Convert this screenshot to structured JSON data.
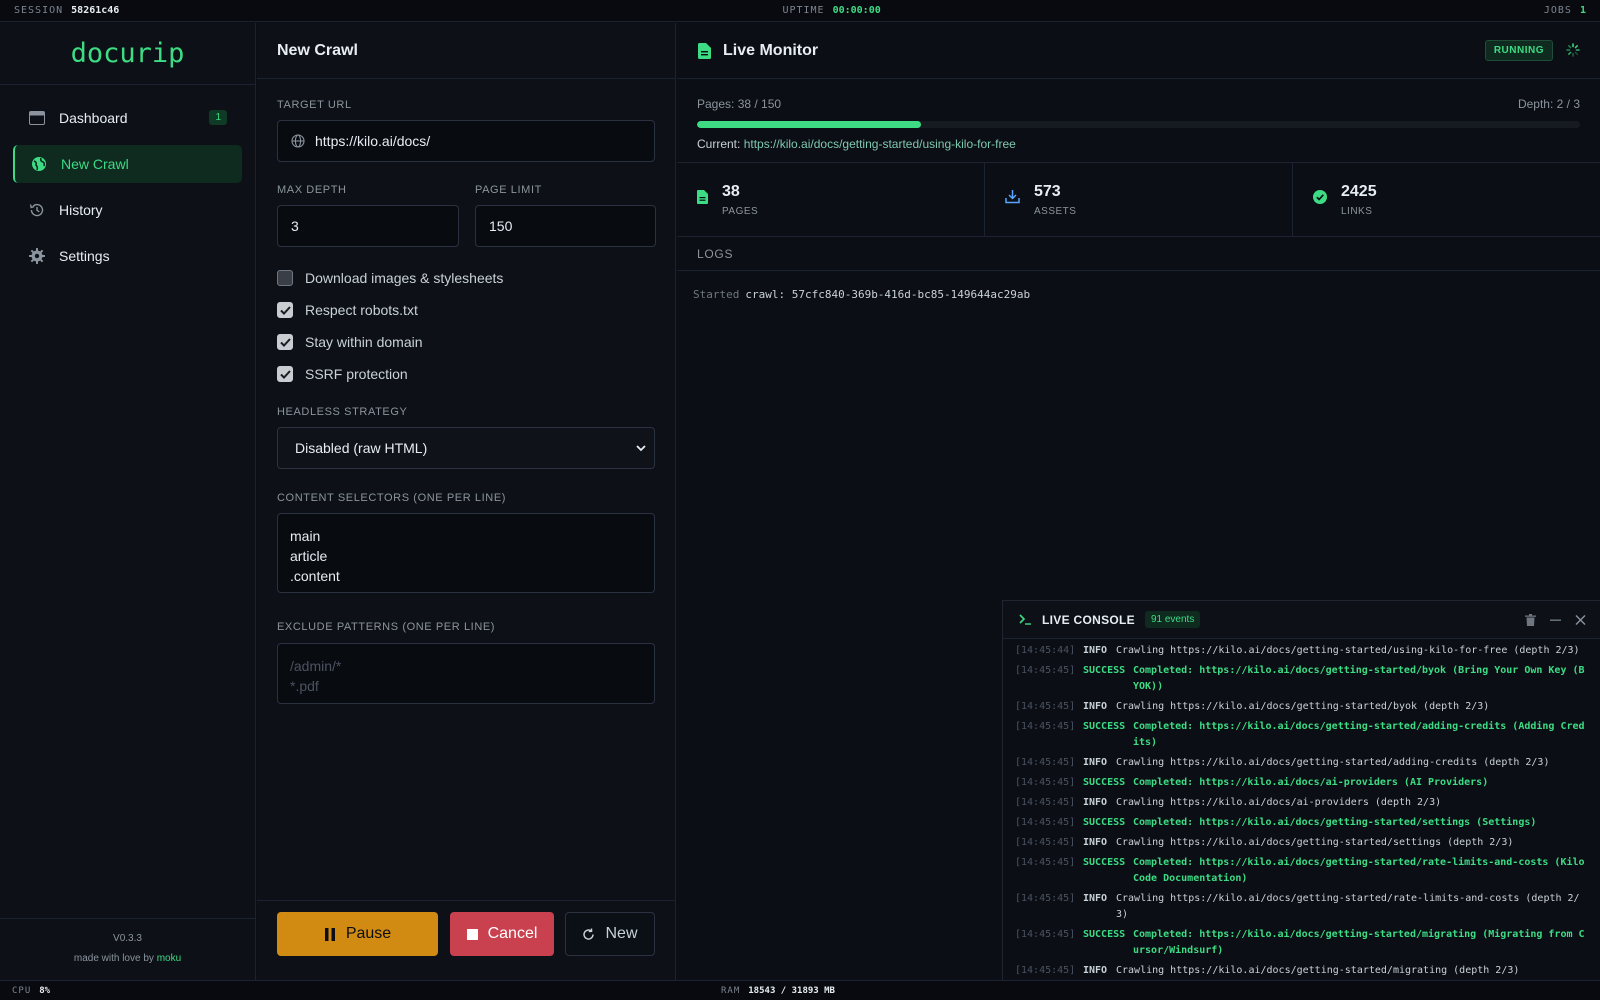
{
  "topbar": {
    "session_label": "SESSION",
    "session_id": "58261c46",
    "uptime_label": "UPTIME",
    "uptime": "00:00:00",
    "jobs_label": "JOBS",
    "jobs": "1"
  },
  "sidebar": {
    "logo": "docurip",
    "items": [
      {
        "label": "Dashboard",
        "icon": "dashboard-icon",
        "badge": "1"
      },
      {
        "label": "New Crawl",
        "icon": "globe-icon",
        "active": true
      },
      {
        "label": "History",
        "icon": "history-icon"
      },
      {
        "label": "Settings",
        "icon": "gear-icon"
      }
    ],
    "version": "V0.3.3",
    "made_with": "made with love by",
    "author": "moku"
  },
  "form": {
    "title": "New Crawl",
    "target_url_label": "TARGET URL",
    "target_url": "https://kilo.ai/docs/",
    "max_depth_label": "MAX DEPTH",
    "max_depth": "3",
    "page_limit_label": "PAGE LIMIT",
    "page_limit": "150",
    "options": [
      {
        "label": "Download images & stylesheets",
        "checked": false
      },
      {
        "label": "Respect robots.txt",
        "checked": true
      },
      {
        "label": "Stay within domain",
        "checked": true
      },
      {
        "label": "SSRF protection",
        "checked": true
      }
    ],
    "headless_label": "HEADLESS STRATEGY",
    "headless_value": "Disabled (raw HTML)",
    "selectors_label": "CONTENT SELECTORS (ONE PER LINE)",
    "selectors": [
      "main",
      "article",
      ".content"
    ],
    "exclude_label": "EXCLUDE PATTERNS (ONE PER LINE)",
    "exclude_placeholder": [
      "/admin/*",
      "*.pdf"
    ],
    "buttons": {
      "pause": "Pause",
      "cancel": "Cancel",
      "new": "New"
    },
    "colors": {
      "pause": "#d18a12",
      "cancel": "#c9404f"
    }
  },
  "monitor": {
    "title": "Live Monitor",
    "status": "RUNNING",
    "pages_progress": "Pages: 38 / 150",
    "progress_fraction": 0.2533,
    "depth_progress": "Depth: 2 / 3",
    "current_label": "Current:",
    "current_url": "https://kilo.ai/docs/getting-started/using-kilo-for-free",
    "stats": [
      {
        "value": "38",
        "label": "PAGES",
        "icon": "document-icon"
      },
      {
        "value": "573",
        "label": "ASSETS",
        "icon": "download-icon"
      },
      {
        "value": "2425",
        "label": "LINKS",
        "icon": "check-circle-icon"
      }
    ],
    "logs_label": "LOGS",
    "log_started": "Started",
    "log_text": "crawl: 57cfc840-369b-416d-bc85-149644ac29ab"
  },
  "console": {
    "title": "LIVE CONSOLE",
    "events": "91 events",
    "lines": [
      {
        "ts": "[14:45:44]",
        "level": "INFO",
        "msg": "Crawling https://kilo.ai/docs/getting-started/using-kilo-for-free (depth 2/3)"
      },
      {
        "ts": "[14:45:45]",
        "level": "SUCCESS",
        "msg": "Completed: https://kilo.ai/docs/getting-started/byok (Bring Your Own Key (BYOK))"
      },
      {
        "ts": "[14:45:45]",
        "level": "INFO",
        "msg": "Crawling https://kilo.ai/docs/getting-started/byok (depth 2/3)"
      },
      {
        "ts": "[14:45:45]",
        "level": "SUCCESS",
        "msg": "Completed: https://kilo.ai/docs/getting-started/adding-credits (Adding Credits)"
      },
      {
        "ts": "[14:45:45]",
        "level": "INFO",
        "msg": "Crawling https://kilo.ai/docs/getting-started/adding-credits (depth 2/3)"
      },
      {
        "ts": "[14:45:45]",
        "level": "SUCCESS",
        "msg": "Completed: https://kilo.ai/docs/ai-providers (AI Providers)"
      },
      {
        "ts": "[14:45:45]",
        "level": "INFO",
        "msg": "Crawling https://kilo.ai/docs/ai-providers (depth 2/3)"
      },
      {
        "ts": "[14:45:45]",
        "level": "SUCCESS",
        "msg": "Completed: https://kilo.ai/docs/getting-started/settings (Settings)"
      },
      {
        "ts": "[14:45:45]",
        "level": "INFO",
        "msg": "Crawling https://kilo.ai/docs/getting-started/settings (depth 2/3)"
      },
      {
        "ts": "[14:45:45]",
        "level": "SUCCESS",
        "msg": "Completed: https://kilo.ai/docs/getting-started/rate-limits-and-costs (Kilo Code Documentation)"
      },
      {
        "ts": "[14:45:45]",
        "level": "INFO",
        "msg": "Crawling https://kilo.ai/docs/getting-started/rate-limits-and-costs (depth 2/3)"
      },
      {
        "ts": "[14:45:45]",
        "level": "SUCCESS",
        "msg": "Completed: https://kilo.ai/docs/getting-started/migrating (Migrating from Cursor/Windsurf)"
      },
      {
        "ts": "[14:45:45]",
        "level": "INFO",
        "msg": "Crawling https://kilo.ai/docs/getting-started/migrating (depth 2/3)"
      }
    ]
  },
  "bottombar": {
    "cpu_label": "CPU",
    "cpu": "8%",
    "ram_label": "RAM",
    "ram": "18543 / 31893 MB"
  },
  "accent": "#3ddc84"
}
